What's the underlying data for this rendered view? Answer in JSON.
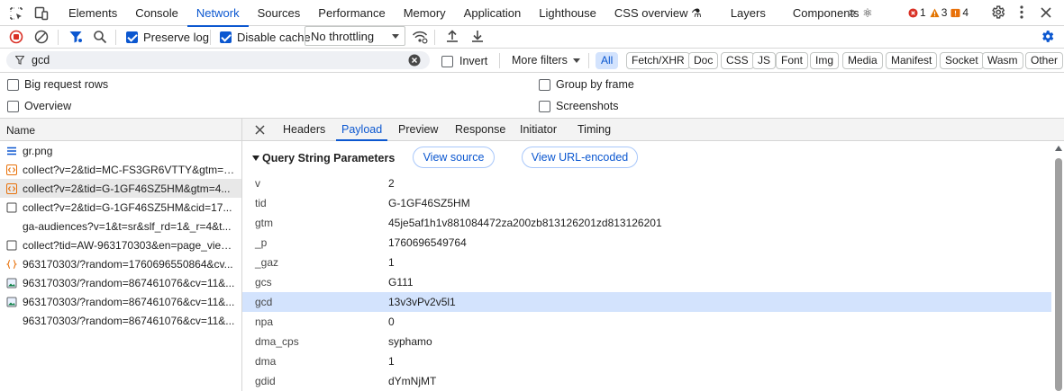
{
  "top_tabs": [
    {
      "label": "Elements"
    },
    {
      "label": "Console"
    },
    {
      "label": "Network",
      "active": true
    },
    {
      "label": "Sources"
    },
    {
      "label": "Performance"
    },
    {
      "label": "Memory"
    },
    {
      "label": "Application"
    },
    {
      "label": "Lighthouse"
    },
    {
      "label": "CSS overview ⚗"
    },
    {
      "label": "Layers"
    },
    {
      "label": "Components ⚛"
    }
  ],
  "status": {
    "errors": "1",
    "warnings": "3",
    "issues": "4"
  },
  "toolbar": {
    "preserve_log": "Preserve log",
    "disable_cache": "Disable cache",
    "throttling": "No throttling"
  },
  "filter": {
    "value": "gcd",
    "invert": "Invert",
    "more_filters": "More filters",
    "types": [
      "All",
      "Fetch/XHR",
      "Doc",
      "CSS",
      "JS",
      "Font",
      "Img",
      "Media",
      "Manifest",
      "Socket",
      "Wasm",
      "Other"
    ]
  },
  "options": {
    "big_rows": "Big request rows",
    "overview": "Overview",
    "group_by_frame": "Group by frame",
    "screenshots": "Screenshots"
  },
  "list": {
    "header": "Name",
    "requests": [
      "gr.png",
      "collect?v=2&tid=MC-FS3GR6VTTY&gtm=4...",
      "collect?v=2&tid=G-1GF46SZ5HM&gtm=4...",
      "collect?v=2&tid=G-1GF46SZ5HM&cid=17...",
      "ga-audiences?v=1&t=sr&slf_rd=1&_r=4&t...",
      "collect?tid=AW-963170303&en=page_view...",
      "963170303/?random=1760696550864&cv...",
      "963170303/?random=867461076&cv=11&...",
      "963170303/?random=867461076&cv=11&...",
      "963170303/?random=867461076&cv=11&..."
    ]
  },
  "detail": {
    "tabs": [
      "Headers",
      "Payload",
      "Preview",
      "Response",
      "Initiator",
      "Timing"
    ],
    "section_title": "Query String Parameters",
    "view_source": "View source",
    "view_url_encoded": "View URL-encoded",
    "params": [
      {
        "key": "v",
        "value": "2"
      },
      {
        "key": "tid",
        "value": "G-1GF46SZ5HM"
      },
      {
        "key": "gtm",
        "value": "45je5af1h1v881084472za200zb813126201zd813126201"
      },
      {
        "key": "_p",
        "value": "1760696549764"
      },
      {
        "key": "_gaz",
        "value": "1"
      },
      {
        "key": "gcs",
        "value": "G111"
      },
      {
        "key": "gcd",
        "value": "13v3vPv2v5l1"
      },
      {
        "key": "npa",
        "value": "0"
      },
      {
        "key": "dma_cps",
        "value": "syphamo"
      },
      {
        "key": "dma",
        "value": "1"
      },
      {
        "key": "gdid",
        "value": "dYmNjMT"
      }
    ]
  },
  "colors": {
    "accent": "#0b57d0",
    "error": "#d93025",
    "warning": "#e37400",
    "issue": "#e8710a"
  }
}
